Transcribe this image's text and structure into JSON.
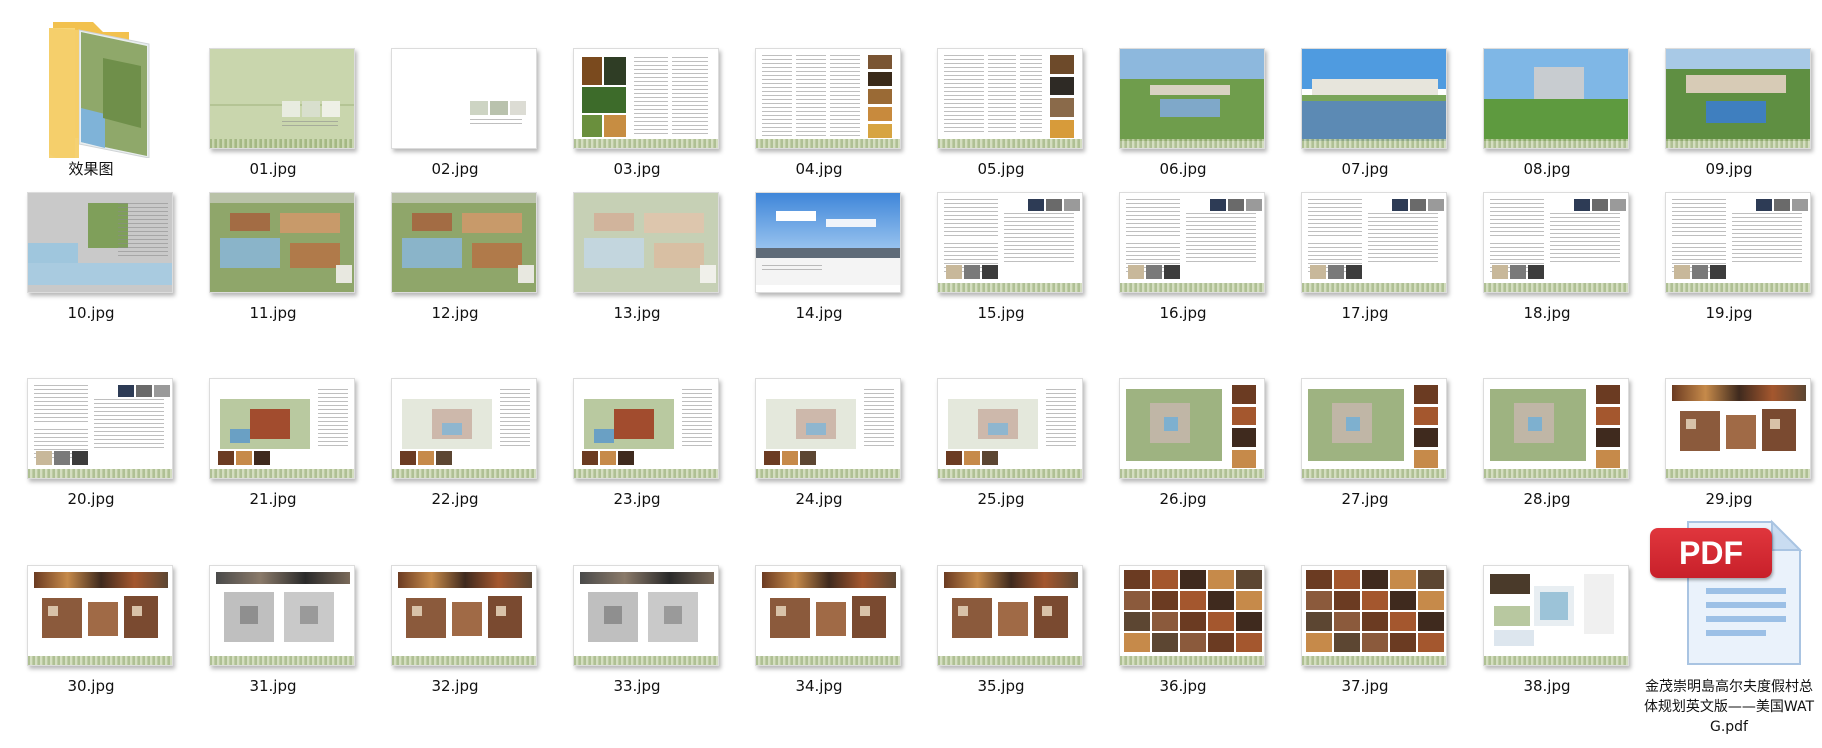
{
  "folder": {
    "label": "效果图",
    "icon": "folder-icon"
  },
  "files": [
    {
      "name": "01.jpg",
      "kind": "cover"
    },
    {
      "name": "02.jpg",
      "kind": "white"
    },
    {
      "name": "03.jpg",
      "kind": "photos-text"
    },
    {
      "name": "04.jpg",
      "kind": "text-photos"
    },
    {
      "name": "05.jpg",
      "kind": "table-photos"
    },
    {
      "name": "06.jpg",
      "kind": "render-green"
    },
    {
      "name": "07.jpg",
      "kind": "render-lake"
    },
    {
      "name": "08.jpg",
      "kind": "render-building"
    },
    {
      "name": "09.jpg",
      "kind": "render-aerial"
    },
    {
      "name": "10.jpg",
      "kind": "map"
    },
    {
      "name": "11.jpg",
      "kind": "site-plan"
    },
    {
      "name": "12.jpg",
      "kind": "site-plan"
    },
    {
      "name": "13.jpg",
      "kind": "site-plan-faded"
    },
    {
      "name": "14.jpg",
      "kind": "sky"
    },
    {
      "name": "15.jpg",
      "kind": "text-doc"
    },
    {
      "name": "16.jpg",
      "kind": "text-doc"
    },
    {
      "name": "17.jpg",
      "kind": "text-doc"
    },
    {
      "name": "18.jpg",
      "kind": "text-doc"
    },
    {
      "name": "19.jpg",
      "kind": "text-doc"
    },
    {
      "name": "20.jpg",
      "kind": "text-doc"
    },
    {
      "name": "21.jpg",
      "kind": "landscape-plan"
    },
    {
      "name": "22.jpg",
      "kind": "landscape-plan-light"
    },
    {
      "name": "23.jpg",
      "kind": "landscape-plan"
    },
    {
      "name": "24.jpg",
      "kind": "landscape-plan-light"
    },
    {
      "name": "25.jpg",
      "kind": "landscape-plan-light"
    },
    {
      "name": "26.jpg",
      "kind": "plan-photos"
    },
    {
      "name": "27.jpg",
      "kind": "plan-photos"
    },
    {
      "name": "28.jpg",
      "kind": "plan-photos"
    },
    {
      "name": "29.jpg",
      "kind": "floor-plan"
    },
    {
      "name": "30.jpg",
      "kind": "floor-plan"
    },
    {
      "name": "31.jpg",
      "kind": "floor-plan-grey"
    },
    {
      "name": "32.jpg",
      "kind": "floor-plan"
    },
    {
      "name": "33.jpg",
      "kind": "floor-plan-grey"
    },
    {
      "name": "34.jpg",
      "kind": "floor-plan"
    },
    {
      "name": "35.jpg",
      "kind": "floor-plan"
    },
    {
      "name": "36.jpg",
      "kind": "photo-grid"
    },
    {
      "name": "37.jpg",
      "kind": "photo-grid"
    },
    {
      "name": "38.jpg",
      "kind": "sketches"
    }
  ],
  "pdf": {
    "badge": "PDF",
    "name": "金茂崇明島高尔夫度假村总体规划英文版——美国WATG.pdf",
    "icon": "pdf-file-icon",
    "badge_color": "#c8202a"
  }
}
